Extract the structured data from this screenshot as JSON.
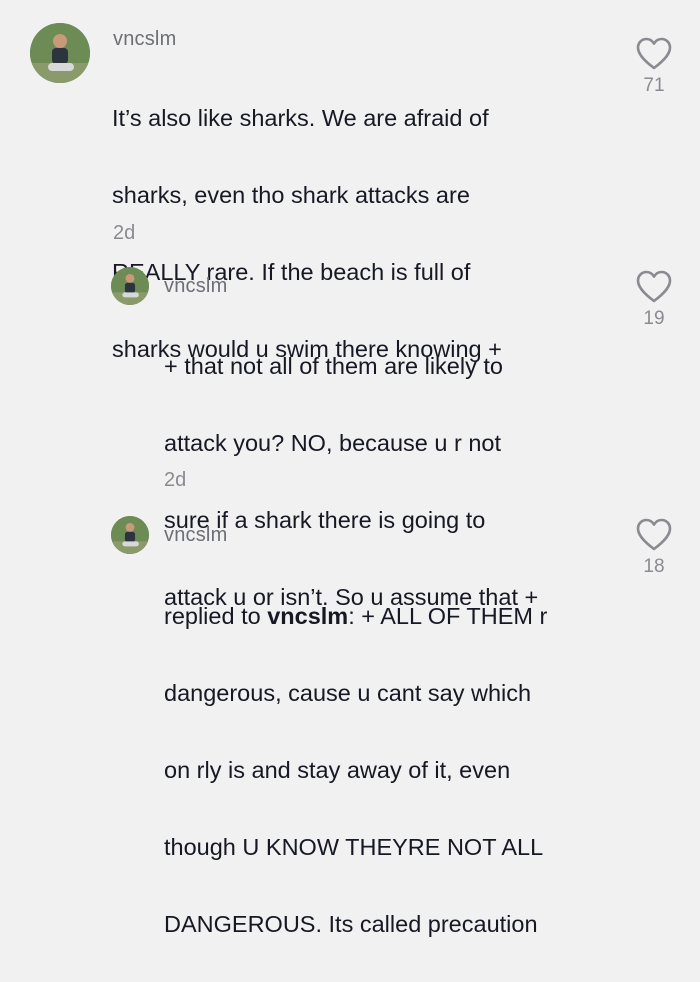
{
  "comments": [
    {
      "username": "vncslm",
      "lines": [
        "It’s also like sharks. We are afraid of",
        "sharks, even tho shark attacks are",
        "REALLY rare. If the beach is full of",
        "sharks would u swim there knowing +"
      ],
      "time": "2d",
      "likes": "71"
    },
    {
      "username": "vncslm",
      "lines": [
        "+ that not all of them are likely to",
        "attack you? NO, because u r not",
        "sure if a shark there is going to",
        "attack u or isn’t. So u assume that +"
      ],
      "time": "2d",
      "likes": "19"
    },
    {
      "username": "vncslm",
      "reply_prefix": "replied to ",
      "reply_target": "vncslm",
      "reply_suffix": ": + ALL OF THEM r",
      "lines": [
        "dangerous, cause u cant say which",
        "on rly is and stay away of it, even",
        "though U KNOW THEYRE NOT ALL",
        "DANGEROUS. Its called precaution"
      ],
      "likes": "18"
    }
  ]
}
